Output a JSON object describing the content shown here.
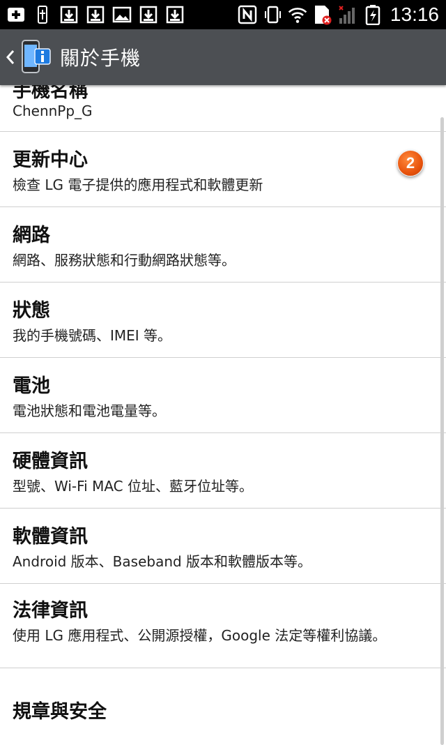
{
  "status_bar": {
    "time": "13:16",
    "left_icons": [
      "add-icon",
      "usb-icon",
      "download-icon",
      "download-icon",
      "image-icon",
      "download-icon",
      "download-icon"
    ],
    "right_icons": [
      "nfc-icon",
      "vibrate-icon",
      "wifi-icon",
      "sim-error-icon",
      "signal-icon",
      "battery-charging-icon"
    ]
  },
  "action_bar": {
    "title": "關於手機"
  },
  "list": {
    "partial_item": {
      "title": "手機名稱",
      "subtitle": "ChennPp_G"
    },
    "items": [
      {
        "title": "更新中心",
        "subtitle": "檢查 LG 電子提供的應用程式和軟體更新",
        "badge": "2"
      },
      {
        "title": "網路",
        "subtitle": "網路、服務狀態和行動網路狀態等。"
      },
      {
        "title": "狀態",
        "subtitle": "我的手機號碼、IMEI 等。"
      },
      {
        "title": "電池",
        "subtitle": "電池狀態和電池電量等。"
      },
      {
        "title": "硬體資訊",
        "subtitle": "型號、Wi-Fi MAC 位址、藍牙位址等。"
      },
      {
        "title": "軟體資訊",
        "subtitle": "Android 版本、Baseband 版本和軟體版本等。"
      },
      {
        "title": "法律資訊",
        "subtitle": "使用 LG 應用程式、公開源授權，Google 法定等權利協議。"
      },
      {
        "title": "規章與安全"
      }
    ]
  },
  "colors": {
    "action_bar": "#4c4f53",
    "badge": "#e8530c",
    "status_bar": "#000000"
  }
}
